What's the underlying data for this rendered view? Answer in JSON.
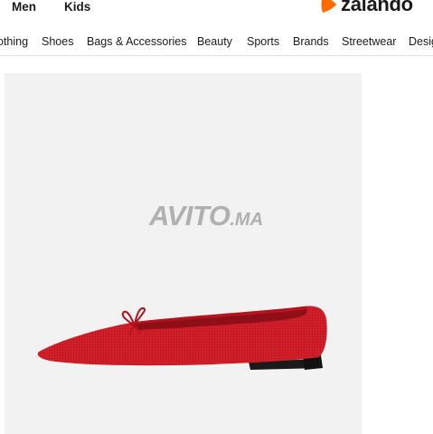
{
  "header": {
    "gender_links": [
      "Men",
      "Kids"
    ],
    "logo_text": "zalando",
    "brand_color": "#ff6900"
  },
  "nav": {
    "items": [
      "othing",
      "Shoes",
      "Bags & Accessories",
      "Beauty",
      "Sports",
      "Brands",
      "Streetwear",
      "Desig"
    ]
  },
  "product": {
    "watermark_main": "AVITO",
    "watermark_ext": ".MA",
    "shoe_color": "#d31f2a",
    "background_color": "#f2f2f2"
  }
}
